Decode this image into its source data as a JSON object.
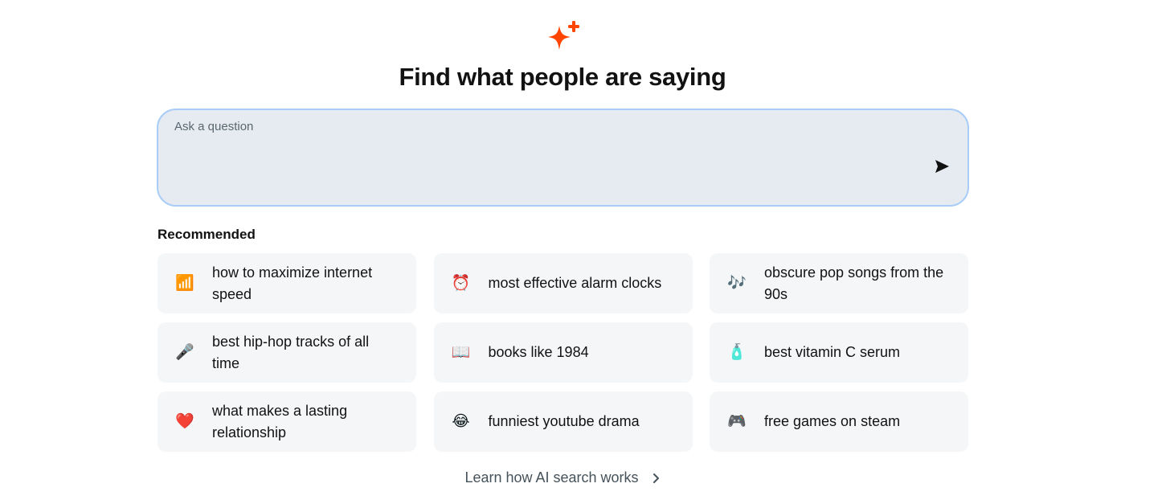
{
  "header": {
    "title": "Find what people are saying",
    "logo_icon": "sparkle-icon",
    "accent_color": "#ff4500"
  },
  "search": {
    "placeholder": "Ask a question",
    "value": "",
    "send_icon": "send-icon",
    "border_color": "#a9cdf7",
    "background_color": "#e5ebf0"
  },
  "recommended": {
    "heading": "Recommended",
    "items": [
      {
        "emoji": "📶",
        "icon": "signal-bars-icon",
        "label": "how to maximize internet speed"
      },
      {
        "emoji": "⏰",
        "icon": "alarm-clock-icon",
        "label": "most effective alarm clocks"
      },
      {
        "emoji": "🎶",
        "icon": "music-notes-icon",
        "label": "obscure pop songs from the 90s"
      },
      {
        "emoji": "🎤",
        "icon": "microphone-icon",
        "label": "best hip-hop tracks of all time"
      },
      {
        "emoji": "📖",
        "icon": "open-book-icon",
        "label": "books like 1984"
      },
      {
        "emoji": "🧴",
        "icon": "lotion-bottle-icon",
        "label": "best vitamin C serum"
      },
      {
        "emoji": "❤️",
        "icon": "heart-icon",
        "label": "what makes a lasting relationship"
      },
      {
        "emoji": "😂",
        "icon": "laughing-face-icon",
        "label": "funniest youtube drama"
      },
      {
        "emoji": "🎮",
        "icon": "game-controller-icon",
        "label": "free games on steam"
      }
    ]
  },
  "footer": {
    "link_label": "Learn how AI search works",
    "link_icon": "chevron-right-icon"
  }
}
